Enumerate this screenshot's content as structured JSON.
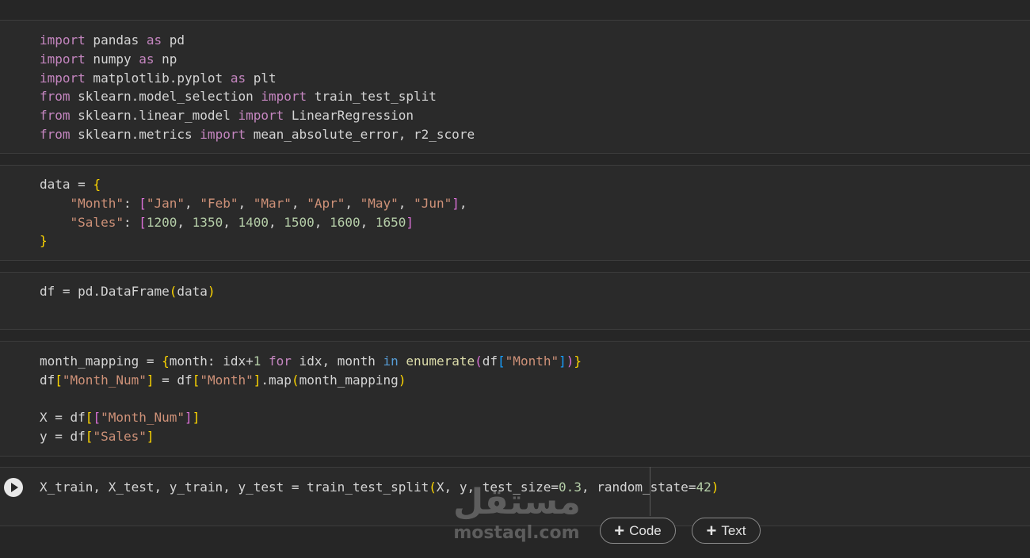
{
  "cells": [
    {
      "lines": [
        [
          [
            "import",
            "kw"
          ],
          [
            " pandas ",
            ""
          ],
          [
            "as",
            "kw"
          ],
          [
            " pd",
            ""
          ]
        ],
        [
          [
            "import",
            "kw"
          ],
          [
            " numpy ",
            ""
          ],
          [
            "as",
            "kw"
          ],
          [
            " np",
            ""
          ]
        ],
        [
          [
            "import",
            "kw"
          ],
          [
            " matplotlib.pyplot ",
            ""
          ],
          [
            "as",
            "kw"
          ],
          [
            " plt",
            ""
          ]
        ],
        [
          [
            "from",
            "kw"
          ],
          [
            " sklearn.model_selection ",
            ""
          ],
          [
            "import",
            "kw"
          ],
          [
            " train_test_split",
            ""
          ]
        ],
        [
          [
            "from",
            "kw"
          ],
          [
            " sklearn.linear_model ",
            ""
          ],
          [
            "import",
            "kw"
          ],
          [
            " LinearRegression",
            ""
          ]
        ],
        [
          [
            "from",
            "kw"
          ],
          [
            " sklearn.metrics ",
            ""
          ],
          [
            "import",
            "kw"
          ],
          [
            " mean_absolute_error, r2_score",
            ""
          ]
        ]
      ]
    },
    {
      "lines": [
        [
          [
            "data = ",
            ""
          ],
          [
            "{",
            "b1"
          ]
        ],
        [
          [
            "    ",
            ""
          ],
          [
            "\"Month\"",
            "str"
          ],
          [
            ": ",
            ""
          ],
          [
            "[",
            "b2"
          ],
          [
            "\"Jan\"",
            "str"
          ],
          [
            ", ",
            ""
          ],
          [
            "\"Feb\"",
            "str"
          ],
          [
            ", ",
            ""
          ],
          [
            "\"Mar\"",
            "str"
          ],
          [
            ", ",
            ""
          ],
          [
            "\"Apr\"",
            "str"
          ],
          [
            ", ",
            ""
          ],
          [
            "\"May\"",
            "str"
          ],
          [
            ", ",
            ""
          ],
          [
            "\"Jun\"",
            "str"
          ],
          [
            "]",
            "b2"
          ],
          [
            ",",
            ""
          ]
        ],
        [
          [
            "    ",
            ""
          ],
          [
            "\"Sales\"",
            "str"
          ],
          [
            ": ",
            ""
          ],
          [
            "[",
            "b2"
          ],
          [
            "1200",
            "num"
          ],
          [
            ", ",
            ""
          ],
          [
            "1350",
            "num"
          ],
          [
            ", ",
            ""
          ],
          [
            "1400",
            "num"
          ],
          [
            ", ",
            ""
          ],
          [
            "1500",
            "num"
          ],
          [
            ", ",
            ""
          ],
          [
            "1600",
            "num"
          ],
          [
            ", ",
            ""
          ],
          [
            "1650",
            "num"
          ],
          [
            "]",
            "b2"
          ]
        ],
        [
          [
            "}",
            "b1"
          ]
        ]
      ]
    },
    {
      "lines": [
        [
          [
            "df = pd.DataFrame",
            ""
          ],
          [
            "(",
            "b1"
          ],
          [
            "data",
            ""
          ],
          [
            ")",
            "b1"
          ]
        ]
      ]
    },
    {
      "lines": [
        [
          [
            "month_mapping = ",
            ""
          ],
          [
            "{",
            "b1"
          ],
          [
            "month: idx+",
            ""
          ],
          [
            "1",
            "num"
          ],
          [
            " ",
            ""
          ],
          [
            "for",
            "kw"
          ],
          [
            " idx, month ",
            ""
          ],
          [
            "in",
            "kb"
          ],
          [
            " ",
            ""
          ],
          [
            "enumerate",
            "fn"
          ],
          [
            "(",
            "b2"
          ],
          [
            "df",
            ""
          ],
          [
            "[",
            "b3"
          ],
          [
            "\"Month\"",
            "str"
          ],
          [
            "]",
            "b3"
          ],
          [
            ")",
            "b2"
          ],
          [
            "}",
            "b1"
          ]
        ],
        [
          [
            "df",
            ""
          ],
          [
            "[",
            "b1"
          ],
          [
            "\"Month_Num\"",
            "str"
          ],
          [
            "]",
            "b1"
          ],
          [
            " = df",
            ""
          ],
          [
            "[",
            "b1"
          ],
          [
            "\"Month\"",
            "str"
          ],
          [
            "]",
            "b1"
          ],
          [
            ".map",
            ""
          ],
          [
            "(",
            "b1"
          ],
          [
            "month_mapping",
            ""
          ],
          [
            ")",
            "b1"
          ]
        ],
        [
          [
            "",
            ""
          ]
        ],
        [
          [
            "X = df",
            ""
          ],
          [
            "[",
            "b1"
          ],
          [
            "[",
            "b2"
          ],
          [
            "\"Month_Num\"",
            "str"
          ],
          [
            "]",
            "b2"
          ],
          [
            "]",
            "b1"
          ]
        ],
        [
          [
            "y = df",
            ""
          ],
          [
            "[",
            "b1"
          ],
          [
            "\"Sales\"",
            "str"
          ],
          [
            "]",
            "b1"
          ]
        ]
      ]
    },
    {
      "lines": [
        [
          [
            "X_train, X_test, y_train, y_test = train_test_split",
            ""
          ],
          [
            "(",
            "b1"
          ],
          [
            "X, y, test_size=",
            ""
          ],
          [
            "0.3",
            "num"
          ],
          [
            ", random_state=",
            ""
          ],
          [
            "42",
            "num"
          ],
          [
            ")",
            "b1"
          ]
        ]
      ]
    }
  ],
  "toolbar": {
    "add_code_label": "Code",
    "add_text_label": "Text",
    "plus_glyph": "+"
  },
  "watermark": {
    "logo_text": "مستقل",
    "site_text": "mostaql.com"
  }
}
